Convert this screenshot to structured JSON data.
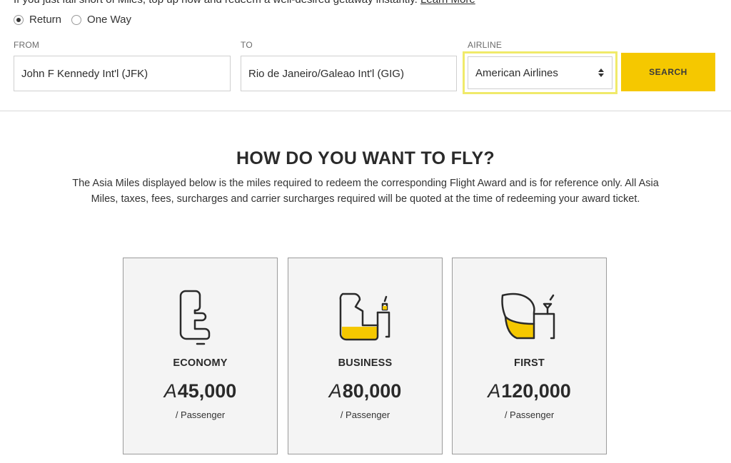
{
  "top_note": {
    "text": "If you just fall short of Miles, top up now and redeem a well-desired getaway instantly.",
    "link": "Learn More"
  },
  "trip_type": {
    "options": [
      "Return",
      "One Way"
    ],
    "selected": "Return"
  },
  "form": {
    "from": {
      "label": "FROM",
      "value": "John F Kennedy Int'l (JFK)"
    },
    "to": {
      "label": "TO",
      "value": "Rio de Janeiro/Galeao Int'l (GIG)"
    },
    "airline": {
      "label": "AIRLINE",
      "value": "American Airlines"
    },
    "search_label": "SEARCH"
  },
  "section": {
    "title": "HOW DO YOU WANT TO FLY?",
    "description": "The Asia Miles displayed below is the miles required to redeem the corresponding Flight Award and is for reference only. All Asia Miles, taxes, fees, surcharges and carrier surcharges required will be quoted at the time of redeeming your award ticket."
  },
  "cabins": [
    {
      "name": "ECONOMY",
      "miles": "45,000",
      "unit": "/ Passenger",
      "icon": "economy-seat-icon"
    },
    {
      "name": "BUSINESS",
      "miles": "80,000",
      "unit": "/ Passenger",
      "icon": "business-seat-icon"
    },
    {
      "name": "FIRST",
      "miles": "120,000",
      "unit": "/ Passenger",
      "icon": "first-seat-icon"
    }
  ],
  "currency_symbol": "A",
  "colors": {
    "accent": "#f5c800",
    "highlight": "#f0ea6a"
  }
}
